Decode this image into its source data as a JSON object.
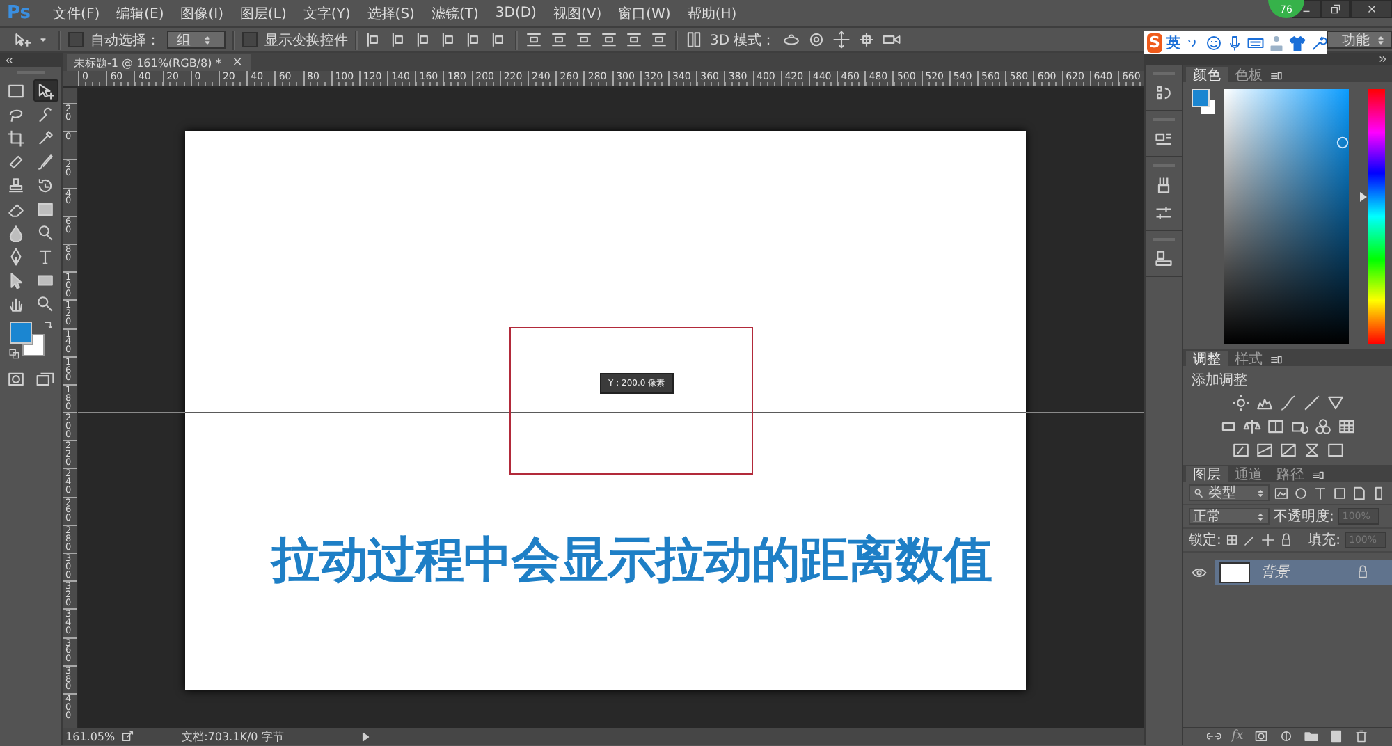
{
  "app": {
    "logo": "Ps",
    "menus": [
      "文件(F)",
      "编辑(E)",
      "图像(I)",
      "图层(L)",
      "文字(Y)",
      "选择(S)",
      "滤镜(T)",
      "3D(D)",
      "视图(V)",
      "窗口(W)",
      "帮助(H)"
    ]
  },
  "notification_badge": "76",
  "options_bar": {
    "auto_select": {
      "label": "自动选择：",
      "checked": false
    },
    "auto_select_target": "组",
    "transform_controls": {
      "label": "显示变换控件",
      "checked": false
    },
    "mode_3d_label": "3D 模式：",
    "workspace": "功能"
  },
  "ime_toolbar": {
    "logo": "S",
    "language": "英"
  },
  "document_tab": {
    "title": "未标题-1 @ 161%(RGB/8) *",
    "close": "×"
  },
  "rulers": {
    "horizontal": [
      "0",
      "60",
      "40",
      "20",
      "0",
      "20",
      "40",
      "60",
      "80",
      "100",
      "120",
      "140",
      "160",
      "180",
      "200",
      "220",
      "240",
      "260",
      "280",
      "300",
      "320",
      "340",
      "360",
      "380",
      "400",
      "420",
      "440",
      "460",
      "480",
      "500",
      "520",
      "540",
      "560",
      "580",
      "600",
      "620",
      "640",
      "660"
    ],
    "vertical": [
      "20",
      "0",
      "20",
      "40",
      "60",
      "80",
      "100",
      "120",
      "140",
      "160",
      "180",
      "200",
      "220",
      "240",
      "260",
      "280",
      "300",
      "320",
      "340",
      "360",
      "380",
      "400"
    ]
  },
  "tools": [
    {
      "selected": false
    },
    {
      "selected": true
    },
    {
      "selected": false
    },
    {
      "selected": false
    },
    {
      "selected": false
    },
    {
      "selected": false
    },
    {
      "selected": false
    },
    {
      "selected": false
    },
    {
      "selected": false
    },
    {
      "selected": false
    },
    {
      "selected": false
    },
    {
      "selected": false
    },
    {
      "selected": false
    },
    {
      "selected": false
    },
    {
      "selected": false
    },
    {
      "selected": false
    },
    {
      "selected": false
    },
    {
      "selected": false
    },
    {
      "selected": false
    },
    {
      "selected": false
    }
  ],
  "canvas": {
    "tooltip": "Y : 200.0 像素",
    "caption": "拉动过程中会显示拉动的距离数值"
  },
  "status_bar": {
    "zoom": "161.05%",
    "document_info": "文档:703.1K/0 字节"
  },
  "color_panel": {
    "tabs": [
      {
        "label": "颜色",
        "selected": true
      },
      {
        "label": "色板",
        "selected": false
      }
    ]
  },
  "adjustments_panel": {
    "tabs": [
      {
        "label": "调整",
        "selected": true
      },
      {
        "label": "样式",
        "selected": false
      }
    ],
    "heading": "添加调整"
  },
  "layers_panel": {
    "tabs": [
      {
        "label": "图层",
        "selected": true
      },
      {
        "label": "通道",
        "selected": false
      },
      {
        "label": "路径",
        "selected": false
      }
    ],
    "filter": "类型",
    "blend_mode": "正常",
    "opacity_label": "不透明度:",
    "opacity": "100%",
    "lock_label": "锁定:",
    "fill_label": "填充:",
    "fill": "100%",
    "fx": "fx",
    "layers": [
      {
        "name": "背景",
        "selected": true,
        "visible": true,
        "locked": true
      }
    ]
  }
}
